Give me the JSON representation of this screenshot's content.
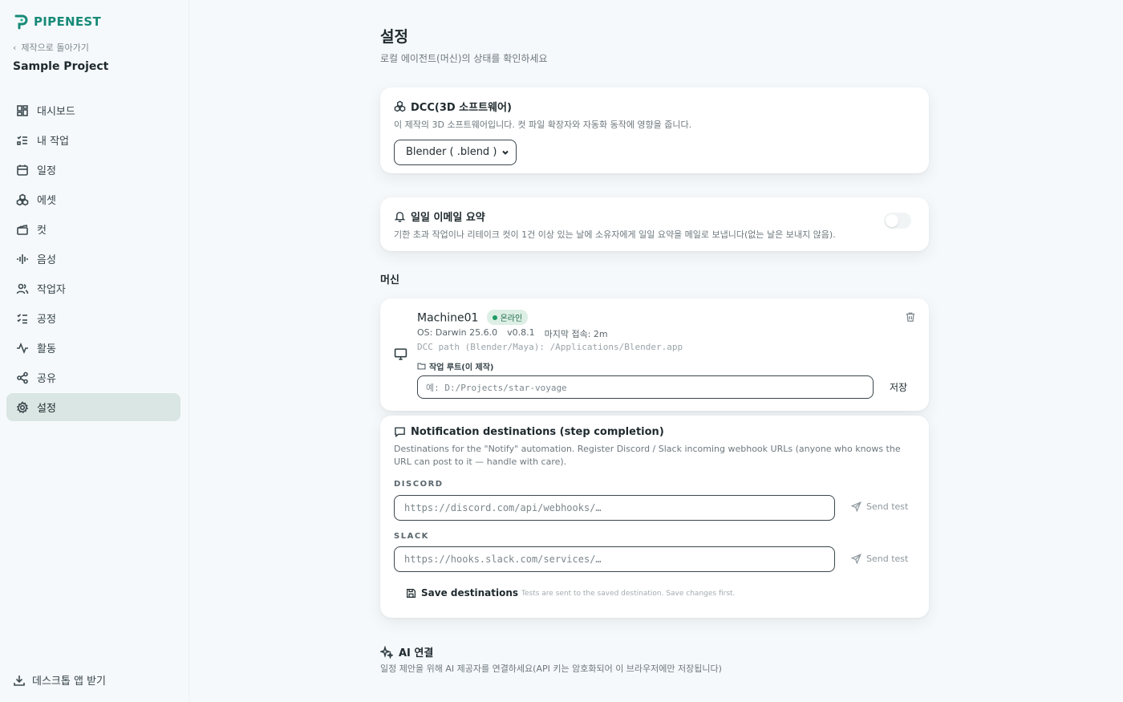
{
  "brand": {
    "name": "PIPENEST",
    "color": "#178a78"
  },
  "sidebar": {
    "back_label": "제작으로 돌아가기",
    "project_name": "Sample Project",
    "items": [
      {
        "label": "대시보드",
        "icon": "dashboard-icon"
      },
      {
        "label": "내 작업",
        "icon": "checklist-icon"
      },
      {
        "label": "일정",
        "icon": "calendar-icon"
      },
      {
        "label": "에셋",
        "icon": "assets-icon"
      },
      {
        "label": "컷",
        "icon": "clapper-icon"
      },
      {
        "label": "음성",
        "icon": "audio-wave-icon"
      },
      {
        "label": "작업자",
        "icon": "users-icon"
      },
      {
        "label": "공정",
        "icon": "process-list-icon"
      },
      {
        "label": "활동",
        "icon": "activity-icon"
      },
      {
        "label": "공유",
        "icon": "share-icon"
      },
      {
        "label": "설정",
        "icon": "gear-icon",
        "active": true
      }
    ],
    "desktop_app_label": "데스크톱 앱 받기"
  },
  "page": {
    "title": "설정",
    "subtitle": "로컬 에이전트(머신)의 상태를 확인하세요"
  },
  "dcc": {
    "title": "DCC(3D 소프트웨어)",
    "description": "이 제작의 3D 소프트웨어입니다. 컷 파일 확장자와 자동화 동작에 영향을 줍니다.",
    "selected": "Blender ( .blend )"
  },
  "email_summary": {
    "title": "일일 이메일 요약",
    "description": "기한 초과 작업이나 리테이크 컷이 1건 이상 있는 날에 소유자에게 일일 요약을 메일로 보냅니다(없는 날은 보내지 않음).",
    "enabled": false
  },
  "machines": {
    "section_label": "머신",
    "items": [
      {
        "name": "Machine01",
        "status": "온라인",
        "os": "OS: Darwin 25.6.0",
        "version": "v0.8.1",
        "last_seen": "마지막 접속: 2m",
        "dcc_path": "DCC path (Blender/Maya): /Applications/Blender.app",
        "work_root_label": "작업 루트(이 제작)",
        "work_root_placeholder": "예: D:/Projects/star-voyage",
        "save_label": "저장"
      }
    ]
  },
  "notifications": {
    "title": "Notification destinations (step completion)",
    "description": "Destinations for the \"Notify\" automation. Register Discord / Slack incoming webhook URLs (anyone who knows the URL can post to it — handle with care).",
    "discord_label": "DISCORD",
    "discord_placeholder": "https://discord.com/api/webhooks/…",
    "slack_label": "SLACK",
    "slack_placeholder": "https://hooks.slack.com/services/…",
    "send_test_label": "Send test",
    "save_label": "Save destinations",
    "hint": "Tests are sent to the saved destination. Save changes first."
  },
  "ai": {
    "title": "AI 연결",
    "description": "일정 제안을 위해 AI 제공자를 연결하세요(API 키는 암호화되어 이 브라우저에만 저장됩니다)"
  }
}
